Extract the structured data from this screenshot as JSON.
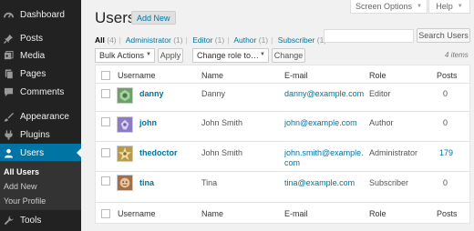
{
  "sidebar": {
    "items": [
      {
        "label": "Dashboard",
        "icon": "dashboard-icon"
      },
      {
        "label": "Posts",
        "icon": "pushpin-icon"
      },
      {
        "label": "Media",
        "icon": "media-icon"
      },
      {
        "label": "Pages",
        "icon": "pages-icon"
      },
      {
        "label": "Comments",
        "icon": "comments-icon"
      },
      {
        "label": "Appearance",
        "icon": "paintbrush-icon"
      },
      {
        "label": "Plugins",
        "icon": "plugin-icon"
      },
      {
        "label": "Users",
        "icon": "users-icon"
      },
      {
        "label": "Tools",
        "icon": "wrench-icon"
      }
    ],
    "submenu": [
      "All Users",
      "Add New",
      "Your Profile"
    ]
  },
  "screen_meta": {
    "screen_options": "Screen Options",
    "help": "Help"
  },
  "header": {
    "title": "Users",
    "add_new": "Add New"
  },
  "filters": [
    {
      "label": "All",
      "count": "(4)"
    },
    {
      "label": "Administrator",
      "count": "(1)"
    },
    {
      "label": "Editor",
      "count": "(1)"
    },
    {
      "label": "Author",
      "count": "(1)"
    },
    {
      "label": "Subscriber",
      "count": "(1)"
    }
  ],
  "search": {
    "button": "Search Users",
    "placeholder": ""
  },
  "bulk": {
    "bulk_actions": "Bulk Actions",
    "apply": "Apply",
    "change_role": "Change role to…",
    "change": "Change"
  },
  "items_count": "4 items",
  "table": {
    "columns": [
      "Username",
      "Name",
      "E-mail",
      "Role",
      "Posts"
    ],
    "rows": [
      {
        "username": "danny",
        "name": "Danny",
        "email": "danny@example.com",
        "email_line2": "",
        "role": "Editor",
        "posts": "0"
      },
      {
        "username": "john",
        "name": "John Smith",
        "email": "john@example.com",
        "email_line2": "",
        "role": "Author",
        "posts": "0"
      },
      {
        "username": "thedoctor",
        "name": "John Smith",
        "email": "john.smith@example.",
        "email_line2": "com",
        "role": "Administrator",
        "posts": "179"
      },
      {
        "username": "tina",
        "name": "Tina",
        "email": "tina@example.com",
        "email_line2": "",
        "role": "Subscriber",
        "posts": "0"
      }
    ]
  },
  "colors": {
    "sidebar_bg": "#222222",
    "accent": "#0074a2",
    "page_bg": "#f1f1f1"
  }
}
